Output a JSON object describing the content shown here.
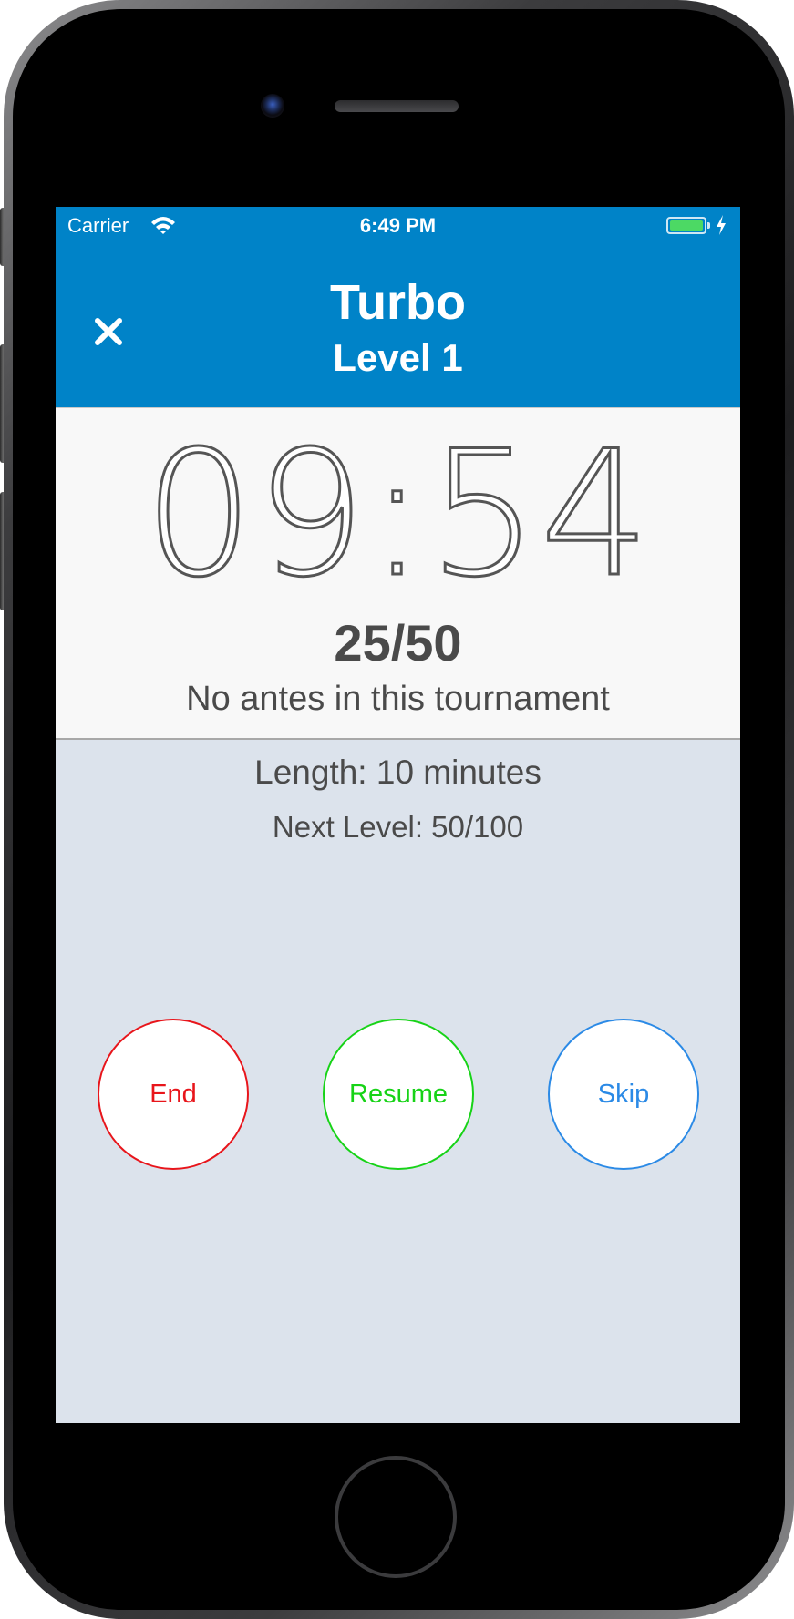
{
  "status_bar": {
    "carrier": "Carrier",
    "time": "6:49 PM",
    "icons": [
      "wifi-icon",
      "battery-icon",
      "charging-bolt-icon"
    ],
    "battery_color": "#4cd964"
  },
  "nav": {
    "title": "Turbo",
    "subtitle": "Level 1",
    "close_icon": "close-icon",
    "background": "#0083c8"
  },
  "timer": {
    "time": "09:54",
    "blinds": "25/50",
    "antes": "No antes in this tournament"
  },
  "details": {
    "length": "Length: 10 minutes",
    "next_level": "Next Level: 50/100"
  },
  "buttons": {
    "end": {
      "label": "End",
      "color": "#e8151b"
    },
    "resume": {
      "label": "Resume",
      "color": "#17d317"
    },
    "skip": {
      "label": "Skip",
      "color": "#2b8ae6"
    }
  }
}
